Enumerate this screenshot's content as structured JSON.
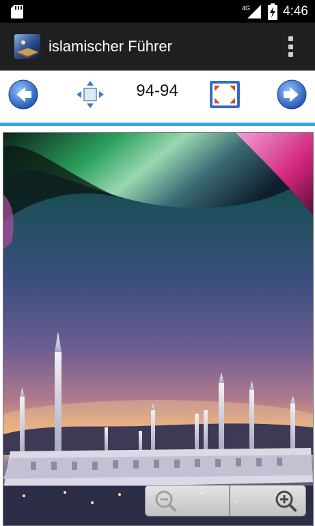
{
  "status_bar": {
    "network": "4G",
    "time": "4:46",
    "icons": [
      "sd-card-icon",
      "signal-icon",
      "battery-charging-icon"
    ]
  },
  "app_bar": {
    "title": "islamischer Führer",
    "icons": [
      "app-icon",
      "overflow-menu-icon"
    ]
  },
  "toolbar": {
    "page_indicator": "94-94",
    "icons": [
      "previous-arrow-icon",
      "move-arrows-icon",
      "fit-screen-icon",
      "next-arrow-icon"
    ]
  },
  "viewer": {
    "image": "mosque-at-sunset",
    "zoom_controls": [
      "zoom-out-icon",
      "zoom-in-icon"
    ]
  },
  "colors": {
    "status_bar": "#000000",
    "app_bar": "#1f1f1f",
    "divider": "#3aa6dc",
    "arrow_blue": "#2a6fd6"
  }
}
